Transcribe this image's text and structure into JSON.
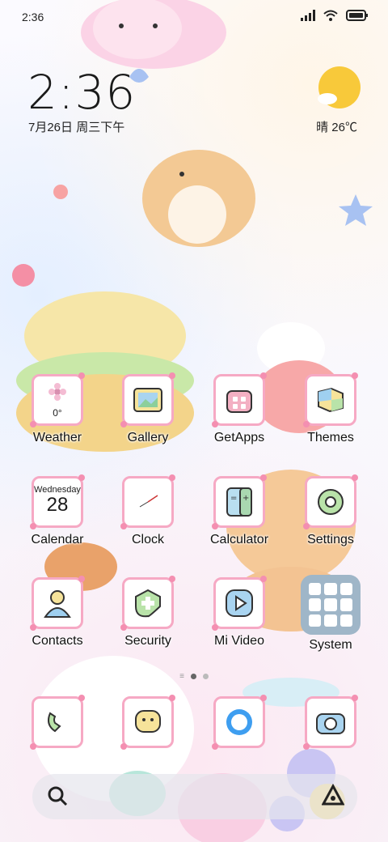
{
  "status": {
    "time": "2:36"
  },
  "lockclock": {
    "time": "2:36",
    "date": "7月26日 周三下午",
    "weather": "晴 26℃"
  },
  "apps_row1": [
    {
      "label": "Weather",
      "sub": "0°"
    },
    {
      "label": "Gallery"
    },
    {
      "label": "GetApps"
    },
    {
      "label": "Themes"
    }
  ],
  "apps_row2": [
    {
      "label": "Calendar",
      "weekday": "Wednesday",
      "day": "28"
    },
    {
      "label": "Clock"
    },
    {
      "label": "Calculator"
    },
    {
      "label": "Settings"
    }
  ],
  "apps_row3": [
    {
      "label": "Contacts"
    },
    {
      "label": "Security"
    },
    {
      "label": "Mi Video"
    },
    {
      "label": "System"
    }
  ],
  "colors": {
    "tile_border": "#f6a9c4",
    "sun": "#f8c93a",
    "system_folder": "#9fb6c8"
  }
}
